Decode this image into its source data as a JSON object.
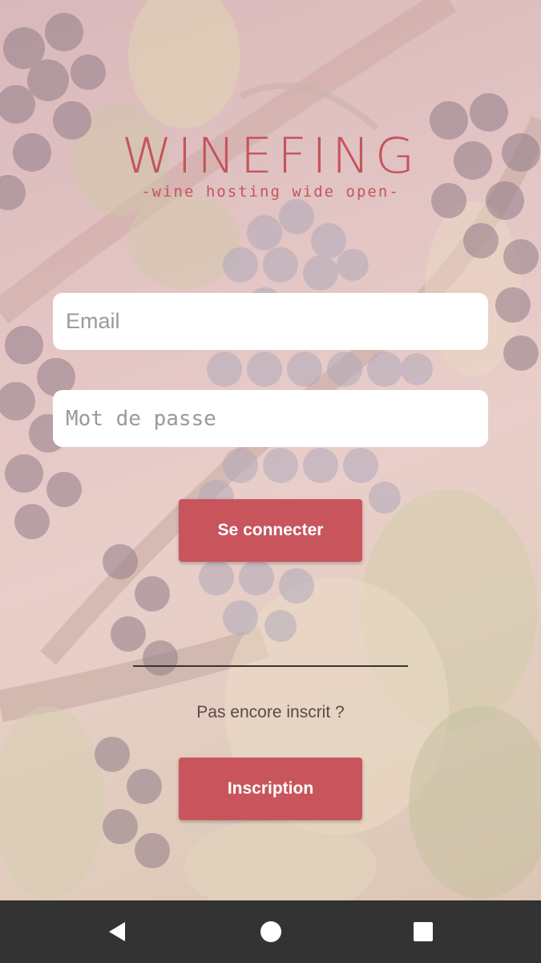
{
  "logo": {
    "title": "WINEFING",
    "tagline": "-wine hosting wide open-"
  },
  "login": {
    "email_placeholder": "Email",
    "password_placeholder": "Mot de passe",
    "submit_label": "Se connecter"
  },
  "signup": {
    "prompt": "Pas encore inscrit ?",
    "button_label": "Inscription"
  },
  "navbar": {
    "back_icon": "back-triangle-icon",
    "home_icon": "home-circle-icon",
    "recent_icon": "recent-apps-square-icon"
  },
  "colors": {
    "brand": "#c4555d",
    "button": "#c8555c",
    "navbar": "#333333"
  }
}
